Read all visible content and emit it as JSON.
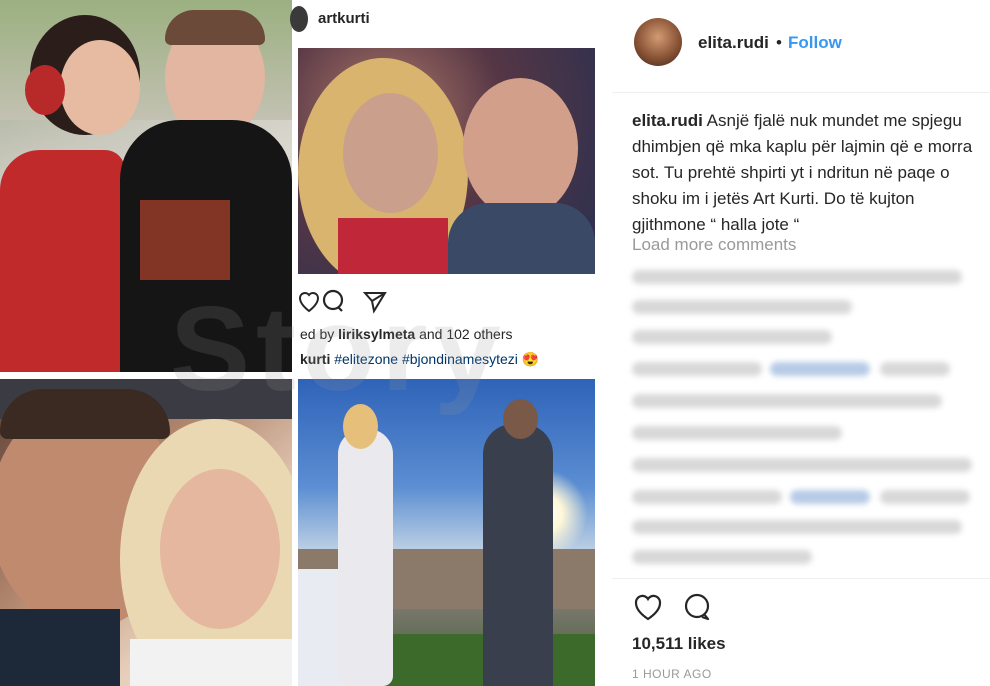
{
  "collage": {
    "mid_post": {
      "username": "artkurti",
      "liked_by_prefix": "ed by ",
      "liked_by_user": "liriksylmeta",
      "liked_by_suffix": " and 102 others",
      "caption_user": "kurti",
      "caption_text": " #elitezone #bjondinamesytezi 😍"
    },
    "watermark": "Story"
  },
  "post": {
    "username": "elita.rudi",
    "separator": "•",
    "follow_label": "Follow",
    "caption_user": "elita.rudi",
    "caption_text": " Asnjë fjalë nuk mundet me spjegu dhimbjen që mka kaplu për lajmin që e morra sot. Tu prehtë shpirti yt i ndritun në paqe o shoku im i jetës Art Kurti. Do të kujton gjithmone “ halla jote “",
    "load_more": "Load more comments",
    "likes": "10,511 likes",
    "time": "1 HOUR AGO"
  },
  "icons": {
    "heart": "heart-icon",
    "comment": "comment-icon",
    "share": "share-icon"
  },
  "colors": {
    "follow": "#3897f0",
    "muted": "#999999",
    "text": "#262626"
  }
}
